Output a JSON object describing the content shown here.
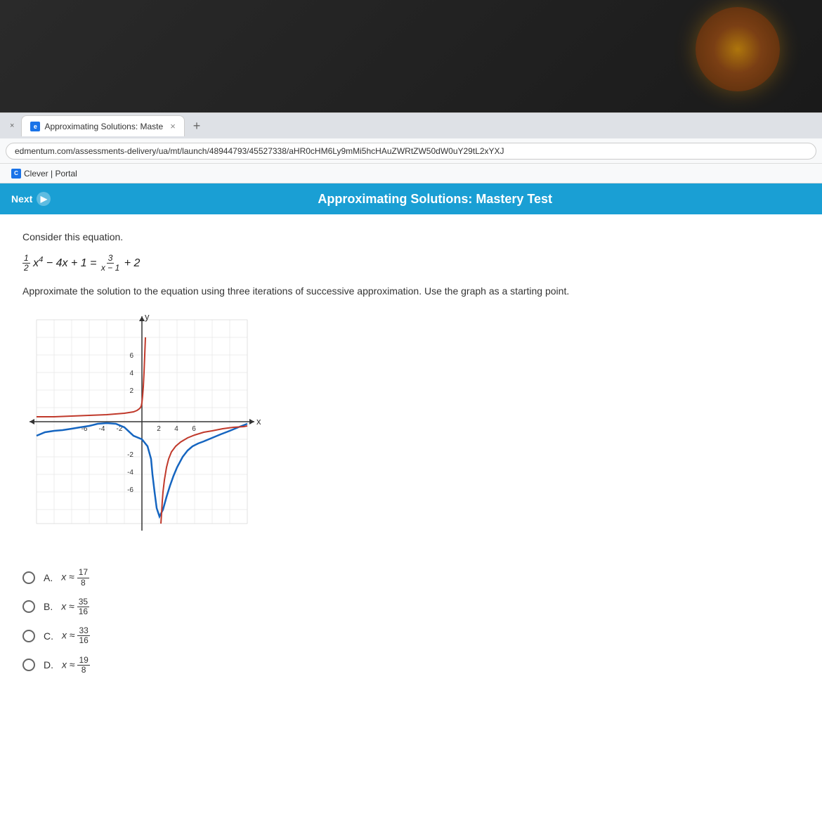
{
  "topBar": {
    "hasDecoration": true
  },
  "browser": {
    "tabs": [
      {
        "id": "tab1",
        "label": "×",
        "isClose": true
      },
      {
        "id": "tab2",
        "favicon": "e",
        "label": "Approximating Solutions: Maste",
        "showClose": true
      },
      {
        "id": "tab3",
        "label": "+"
      }
    ],
    "addressBar": {
      "url": "edmentum.com/assessments-delivery/ua/mt/launch/48944793/45527338/aHR0cHM6Ly9mMi5hcHAuZWRtZW50dW0uY29tL2xYXJ"
    },
    "bookmarks": [
      {
        "favicon": "C",
        "label": "Clever | Portal"
      }
    ]
  },
  "appHeader": {
    "nextLabel": "Next",
    "title": "Approximating Solutions: Mastery Test"
  },
  "content": {
    "questionIntro": "Consider this equation.",
    "instruction": "Approximate the solution to the equation using three iterations of successive approximation. Use the graph as a starting point.",
    "answerChoices": [
      {
        "id": "A",
        "approxSymbol": "≈",
        "numerator": "17",
        "denominator": "8"
      },
      {
        "id": "B",
        "approxSymbol": "≈",
        "numerator": "35",
        "denominator": "16"
      },
      {
        "id": "C",
        "approxSymbol": "≈",
        "numerator": "33",
        "denominator": "16"
      },
      {
        "id": "D",
        "approxSymbol": "≈",
        "numerator": "19",
        "denominator": "8"
      }
    ],
    "graph": {
      "xAxisLabel": "x",
      "yAxisLabel": "y",
      "xMin": -6,
      "xMax": 6,
      "yMin": -6,
      "yMax": 6
    }
  }
}
